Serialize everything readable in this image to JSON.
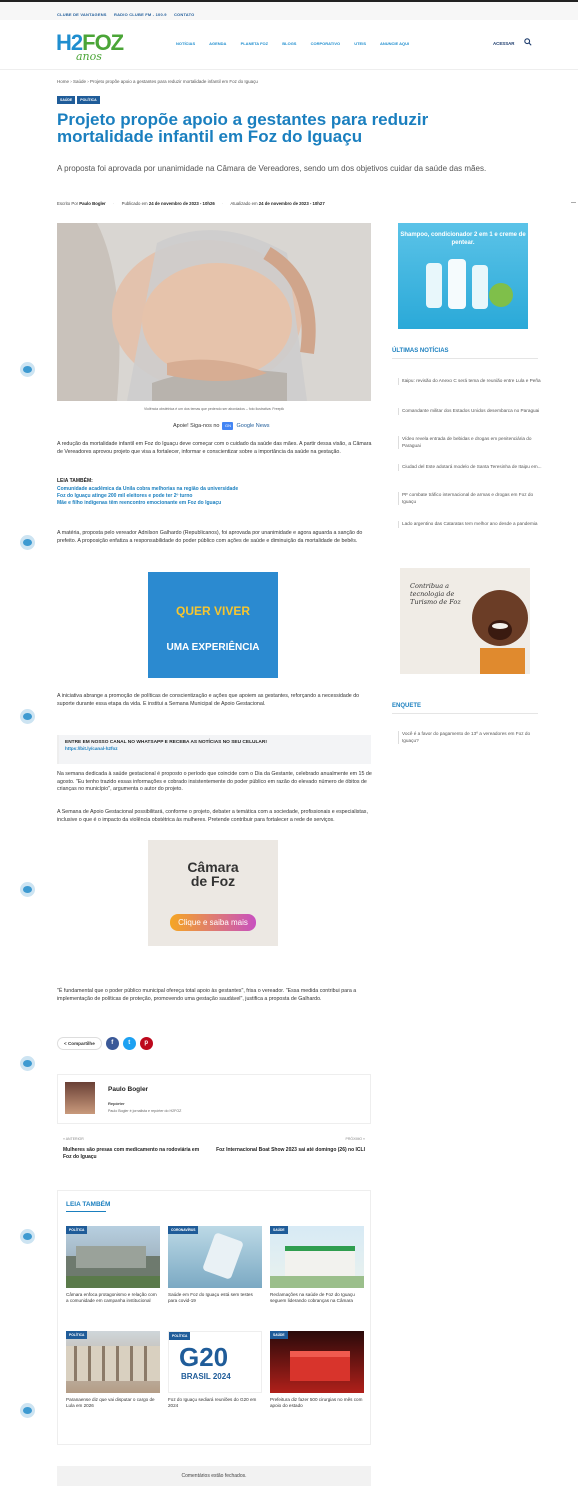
{
  "topbar": {
    "links": [
      "CLUBE DE VANTAGENS",
      "RADIO CLUBE FM - 100.9",
      "CONTATO"
    ]
  },
  "header": {
    "logo_text_h2": "H2",
    "logo_text_foz": "FOZ",
    "logo_text_anos": "anos",
    "nav": [
      "NOTÍCIAS",
      "AGENDA",
      "PLANETA FOZ",
      "BLOGS",
      "CORPORATIVO",
      "UTEIS",
      "ANUNCIE AQUI"
    ],
    "login": "ACESSAR",
    "search_icon": "search-icon"
  },
  "breadcrumb": "Home › Saúde › Projeto propõe apoio a gestantes para reduzir mortalidade infantil em Foz do Iguaçu",
  "tags": [
    "SAÚDE",
    "POLÍTICA"
  ],
  "article": {
    "title": "Projeto propõe apoio a gestantes para reduzir mortalidade infantil em Foz do Iguaçu",
    "subtitle": "A proposta foi aprovada por unanimidade na Câmara de Vereadores, sendo um dos objetivos cuidar da saúde das mães.",
    "meta_author_label": "Escrito Por",
    "meta_author": "Paulo Bogler",
    "meta_published_label": "Publicado em",
    "meta_published": "24 de novembro de 2023 - 10h26",
    "meta_updated_label": "Atualizado em",
    "meta_updated": "24 de novembro de 2023 - 10h27",
    "caption": "Violência obstétrica é um dos temas que pedendo ser abordados – foto ilustrativa: Freepik",
    "follow_label": "Apoie! Siga-nos no",
    "follow_gn": "GN",
    "follow_target": "Google News",
    "p1": "A redução da mortalidade infantil em Foz do Iguaçu deve começar com o cuidado da saúde das mães. A partir dessa visão, a Câmara de Vereadores aprovou projeto que visa a fortalecer, informar e conscientizar sobre a importância da saúde na gestação.",
    "leia_title": "LEIA TAMBÉM:",
    "leia_links": [
      "Comunidade acadêmica da Unila cobra melhorias na região da universidade",
      "Foz do Iguaçu atinge 200 mil eleitores e pode ter 2º turno",
      "Mãe e filho indígenas têm reencontro emocionante em Foz do Iguaçu"
    ],
    "p2": "A matéria, proposta pelo vereador Adnilson Galhardo (Republicanos), foi aprovada por unanimidade e agora aguarda a sanção do prefeito. A proposição enfatiza a responsabilidade do poder público com ações de saúde e diminuição da mortalidade de bebês.",
    "p3": "A iniciativa abrange a promoção de políticas de conscientização e ações que apoiem as gestantes, reforçando a necessidade do suporte durante essa etapa da vida. E institui a Semana Municipal de Apoio Gestacional.",
    "whatsapp_title": "ENTRE EM NOSSO CANAL NO WHATSAPP E RECEBA AS NOTÍCIAS NO SEU CELULAR!",
    "whatsapp_link": "https://bit.ly/canal-h2foz",
    "p4": "Na semana dedicada à saúde gestacional é proposto o período que coincide com o Dia da Gestante, celebrado anualmente em 15 de agosto. \"Eu tenho trazido essas informações e cobrado insistentemente do poder público em razão do elevado número de óbitos de crianças no município\", argumenta o autor do projeto.",
    "p5": "A Semana de Apoio Gestacional possibilitará, conforme o projeto, debater a temática com a sociedade, profissionais e especialistas, inclusive o que é o impacto da violência obstétrica às mulheres. Pretende contribuir para fortalecer a rede de serviços.",
    "p6": "\"É fundamental que o poder público municipal ofereça total apoio às gestantes\", frisa o vereador. \"Essa medida contribui para a implementação de políticas de proteção, promovendo uma gestação saudável\", justifica a proposta de Galhardo.",
    "share_label": "< Compartilhe",
    "share_buttons": [
      "f",
      "t",
      "p"
    ]
  },
  "ads": {
    "ad1_line1_a": "QUER",
    "ad1_line1_b": "VIVER",
    "ad1_line2": "UMA EXPERIÊNCIA",
    "ad2_line1": "Câmara",
    "ad2_line2": "de Foz",
    "ad2_cta": "Clique e saiba mais",
    "sidebar_ad_text": "Shampoo, condicionador 2 em 1 e creme de pentear.",
    "ad3_text": "Contribua a tecnologia de Turismo de Foz"
  },
  "author_box": {
    "name": "Paulo Bogler",
    "role": "Repórter",
    "desc": "Paulo Bogler é jornalista e repórter do H2FOZ"
  },
  "prev_next": {
    "prev_label": "« ANTERIOR",
    "prev_title": "Mulheres são presas com medicamento na rodoviária em Foz do Iguaçu",
    "next_label": "PRÓXIMO »",
    "next_title": "Foz Internacional Boat Show 2023 sai até domingo (26) no ICLI"
  },
  "related": {
    "heading": "LEIA TAMBÉM",
    "items": [
      {
        "cat": "POLÍTICA",
        "title": "Câmara enfoca protagonismo e relação com a comunidade em campanha institucional"
      },
      {
        "cat": "CORONAVÍRUS",
        "title": "Saúde em Foz do Iguaçu está sem testes para covid-19"
      },
      {
        "cat": "SAÚDE",
        "title": "Reclamações na saúde de Foz do Iguaçu seguem liderando cobranças na Câmara"
      },
      {
        "cat": "POLÍTICA",
        "title": "Paranaense diz que vai disputar o cargo de Lula em 2026"
      },
      {
        "cat": "POLÍTICA",
        "title": "Foz do Iguaçu sediará reuniões do G20 em 2024"
      },
      {
        "cat": "SAÚDE",
        "title": "Prefeitura diz fazer 500 cirurgias no mês com apoio do estado"
      }
    ],
    "g20_text": "G20",
    "g20_sub": "BRASIL 2024"
  },
  "sidebar": {
    "latest_heading": "ÚLTIMAS NOTÍCIAS",
    "latest": [
      "Itaipu: revisão do Anexo C será tema de reunião entre Lula e Peña",
      "Comandante militar dos Estados Unidos desembarca no Paraguai",
      "Vídeo revela entrada de bebidas e drogas em penitenciária do Paraguai",
      "Ciudad del Este adotará modelo de Santa Teresinha de Itaipu em...",
      "PF combate tráfico internacional de armas e drogas em Foz do Iguaçu",
      "Lado argentino das Cataratas tem melhor ano desde a pandemia"
    ],
    "poll_heading": "ENQUETE",
    "poll_question": "Você é a favor do pagamento de 13º a vereadores em Foz do Iguaçu?"
  },
  "comments_closed": "Comentários estão fechados."
}
